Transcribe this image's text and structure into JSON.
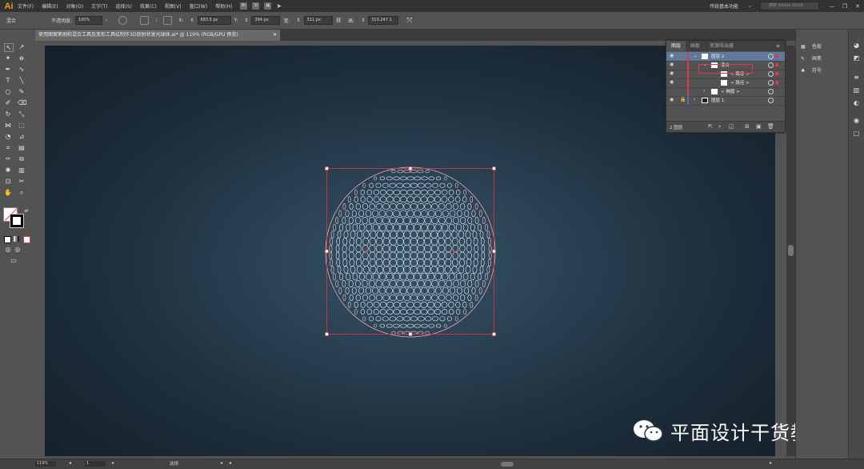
{
  "app": {
    "logo": "Ai"
  },
  "menubar": {
    "items": [
      "文件(F)",
      "编辑(E)",
      "对象(O)",
      "文字(T)",
      "选择(S)",
      "效果(C)",
      "视图(V)",
      "窗口(W)",
      "帮助(H)"
    ],
    "chips": [
      "Br",
      "St"
    ],
    "workspace": "传统基本功能",
    "search_placeholder": "搜索 Adobe Stock",
    "win_buttons": [
      "—",
      "❐",
      "✕"
    ]
  },
  "controlbar": {
    "selection_label": "混合",
    "opacity_label": "不透明度:",
    "opacity_value": "100%",
    "x_label": "X:",
    "x_value": "683.5 px",
    "y_label": "Y:",
    "y_value": "394 px",
    "w_label": "宽:",
    "w_value": "311 px",
    "h_label": "高:",
    "h_value": "310.247 1"
  },
  "document": {
    "tab_title": "使用图案笔刷和混合工具及变形工具绘制作3D放射状发光球体.ai* @ 119% (RGB/GPU 预览)",
    "close": "✕"
  },
  "layers_panel": {
    "tabs": [
      "图层",
      "画板",
      "资源导出器"
    ],
    "active_tab": 0,
    "rows": [
      {
        "name": "图层 2",
        "indent": 0,
        "expanded": true,
        "selected": true,
        "visible": true,
        "color": "#e0364a"
      },
      {
        "name": "混合",
        "indent": 1,
        "expanded": true,
        "selected": false,
        "visible": true,
        "color": "#e0364a"
      },
      {
        "name": "< 路径 >",
        "indent": 2,
        "expanded": false,
        "selected": false,
        "visible": true,
        "color": "#e0364a"
      },
      {
        "name": "< 路径 >",
        "indent": 2,
        "expanded": false,
        "selected": false,
        "visible": true,
        "color": "#e0364a"
      },
      {
        "name": "< 椭圆 >",
        "indent": 1,
        "expanded": false,
        "selected": false,
        "visible": false,
        "color": "#e0364a"
      },
      {
        "name": "图层 1",
        "indent": 0,
        "expanded": false,
        "selected": false,
        "visible": true,
        "color": "#4e6bd6"
      }
    ],
    "footer_label": "2 图层"
  },
  "right_panel": {
    "items": [
      {
        "icon": "swatches-icon",
        "label": "色板"
      },
      {
        "icon": "brushes-icon",
        "label": "画笔"
      },
      {
        "icon": "symbols-icon",
        "label": "符号"
      }
    ]
  },
  "statusbar": {
    "zoom": "119%",
    "page": "1",
    "tool": "选择"
  },
  "watermark": {
    "text": "平面设计干货教程"
  },
  "colors": {
    "selection_accent": "#e0364a",
    "layer_accent": "#4e6bd6",
    "brand": "#ff9a00"
  }
}
